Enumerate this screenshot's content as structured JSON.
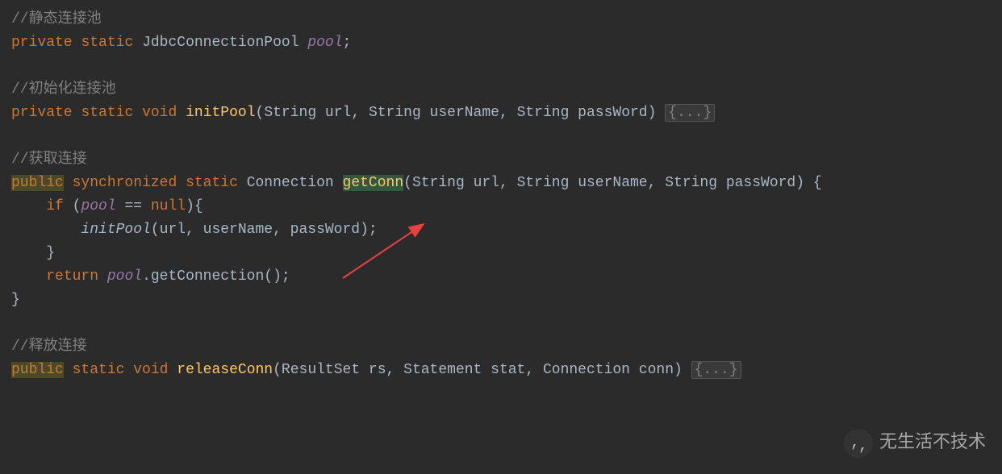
{
  "code": {
    "comment1": "//静态连接池",
    "line1_kw1": "private",
    "line1_kw2": "static",
    "line1_type": "JdbcConnectionPool",
    "line1_field": "pool",
    "line1_semi": ";",
    "comment2": "//初始化连接池",
    "line2_kw1": "private",
    "line2_kw2": "static",
    "line2_kw3": "void",
    "line2_method": "initPool",
    "line2_params": "(String url, String userName, String passWord) ",
    "line2_folded": "{...}",
    "comment3": "//获取连接",
    "line3_kw1": "public",
    "line3_kw2": "synchronized",
    "line3_kw3": "static",
    "line3_type": "Connection",
    "line3_method": "getConn",
    "line3_params": "(String url, String userName, String passWord) {",
    "line4_indent": "    ",
    "line4_kw": "if",
    "line4_open": " (",
    "line4_field": "pool",
    "line4_op": " == ",
    "line4_null": "null",
    "line4_close": "){",
    "line5_indent": "        ",
    "line5_method": "initPool",
    "line5_args": "(url, userName, passWord);",
    "line6_indent": "    ",
    "line6_brace": "}",
    "line7_indent": "    ",
    "line7_kw": "return",
    "line7_sp": " ",
    "line7_field": "pool",
    "line7_call": ".getConnection();",
    "line8_brace": "}",
    "comment4": "//释放连接",
    "line9_kw1": "public",
    "line9_kw2": "static",
    "line9_kw3": "void",
    "line9_method": "releaseConn",
    "line9_params": "(ResultSet rs, Statement stat, Connection conn) ",
    "line9_folded": "{...}"
  },
  "watermark": {
    "text": "无生活不技术"
  }
}
